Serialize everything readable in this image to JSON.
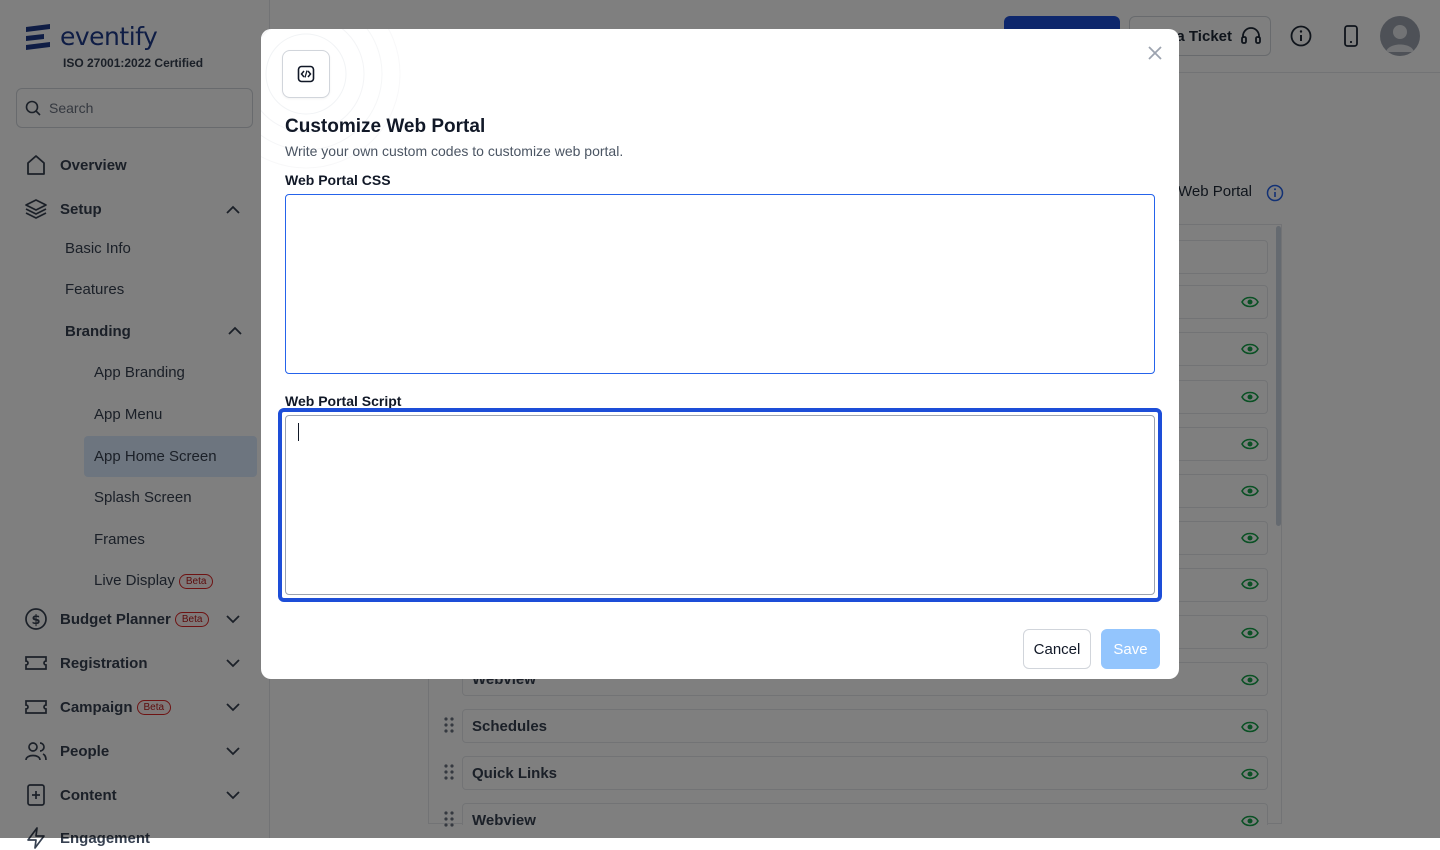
{
  "app": {
    "logo_text": "eventify",
    "certification": "ISO 27001:2022 Certified"
  },
  "sidebar": {
    "search_placeholder": "Search",
    "overview": "Overview",
    "setup": "Setup",
    "setup_items": [
      "Basic Info",
      "Features"
    ],
    "branding": "Branding",
    "branding_items": [
      "App Branding",
      "App Menu",
      "App Home Screen",
      "Splash Screen",
      "Frames",
      "Live Display"
    ],
    "active_item": "App Home Screen",
    "beta_label": "Beta",
    "budget_planner": "Budget Planner",
    "registration": "Registration",
    "campaign": "Campaign",
    "people": "People",
    "content": "Content",
    "engagement": "Engagement"
  },
  "header": {
    "ticket_label": "a Ticket"
  },
  "background": {
    "web_portal_label": "Web Portal",
    "rows": [
      "Webview",
      "Schedules",
      "Quick Links",
      "Webview"
    ]
  },
  "modal": {
    "title": "Customize Web Portal",
    "subtitle": "Write your own custom codes to customize web portal.",
    "css_label": "Web Portal CSS",
    "css_value": "",
    "script_label": "Web Portal Script",
    "script_value": "",
    "cancel_label": "Cancel",
    "save_label": "Save"
  },
  "colors": {
    "brand": "#1e3a8a",
    "primary": "#1d4ed8",
    "save_disabled": "#93c5fd",
    "eye_green": "#16a34a"
  }
}
